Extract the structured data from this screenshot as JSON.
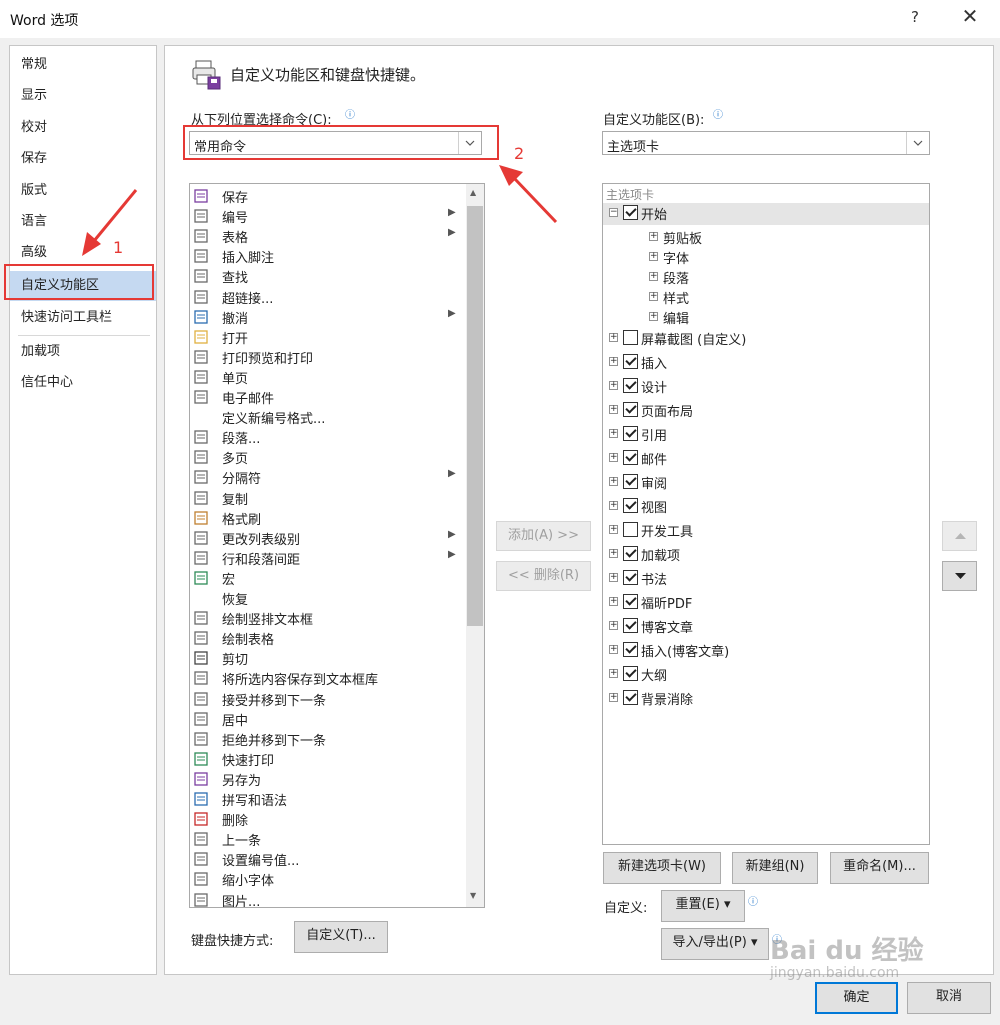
{
  "window": {
    "title": "Word 选项",
    "help": "?",
    "close": "✕"
  },
  "nav": {
    "items": [
      {
        "label": "常规"
      },
      {
        "label": "显示"
      },
      {
        "label": "校对"
      },
      {
        "label": "保存"
      },
      {
        "label": "版式"
      },
      {
        "label": "语言"
      },
      {
        "label": "高级"
      },
      {
        "label": "自定义功能区"
      },
      {
        "label": "快速访问工具栏"
      },
      {
        "label": "加载项"
      },
      {
        "label": "信任中心"
      }
    ],
    "selected": "自定义功能区"
  },
  "header": {
    "title": "自定义功能区和键盘快捷键。"
  },
  "left": {
    "choose_label": "从下列位置选择命令(C):",
    "choose_value": "常用命令",
    "commands": [
      {
        "label": "保存",
        "icon": "save-icon"
      },
      {
        "label": "编号",
        "icon": "numbering-icon",
        "submenu": true
      },
      {
        "label": "表格",
        "icon": "table-icon",
        "submenu": true
      },
      {
        "label": "插入脚注",
        "icon": "footnote-icon"
      },
      {
        "label": "查找",
        "icon": "find-icon"
      },
      {
        "label": "超链接...",
        "icon": "hyperlink-icon"
      },
      {
        "label": "撤消",
        "icon": "undo-icon",
        "submenu": true
      },
      {
        "label": "打开",
        "icon": "open-folder-icon"
      },
      {
        "label": "打印预览和打印",
        "icon": "print-preview-icon"
      },
      {
        "label": "单页",
        "icon": "single-page-icon"
      },
      {
        "label": "电子邮件",
        "icon": "email-icon"
      },
      {
        "label": "定义新编号格式...",
        "icon": ""
      },
      {
        "label": "段落...",
        "icon": "paragraph-icon"
      },
      {
        "label": "多页",
        "icon": "multi-page-icon"
      },
      {
        "label": "分隔符",
        "icon": "break-icon",
        "submenu": true
      },
      {
        "label": "复制",
        "icon": "copy-icon"
      },
      {
        "label": "格式刷",
        "icon": "format-painter-icon"
      },
      {
        "label": "更改列表级别",
        "icon": "list-level-icon",
        "submenu": true
      },
      {
        "label": "行和段落间距",
        "icon": "line-spacing-icon",
        "submenu": true
      },
      {
        "label": "宏",
        "icon": "macro-icon"
      },
      {
        "label": "恢复",
        "icon": ""
      },
      {
        "label": "绘制竖排文本框",
        "icon": "vertical-textbox-icon"
      },
      {
        "label": "绘制表格",
        "icon": "draw-table-icon"
      },
      {
        "label": "剪切",
        "icon": "cut-icon"
      },
      {
        "label": "将所选内容保存到文本框库",
        "icon": "save-to-gallery-icon"
      },
      {
        "label": "接受并移到下一条",
        "icon": "accept-next-icon"
      },
      {
        "label": "居中",
        "icon": "center-icon"
      },
      {
        "label": "拒绝并移到下一条",
        "icon": "reject-next-icon"
      },
      {
        "label": "快速打印",
        "icon": "quick-print-icon"
      },
      {
        "label": "另存为",
        "icon": "save-as-icon"
      },
      {
        "label": "拼写和语法",
        "icon": "spelling-icon"
      },
      {
        "label": "删除",
        "icon": "delete-icon"
      },
      {
        "label": "上一条",
        "icon": "previous-icon"
      },
      {
        "label": "设置编号值...",
        "icon": "numbering-value-icon"
      },
      {
        "label": "缩小字体",
        "icon": "shrink-font-icon"
      },
      {
        "label": "图片...",
        "icon": "picture-icon"
      }
    ],
    "shortcut_label": "键盘快捷方式:",
    "shortcut_button": "自定义(T)..."
  },
  "middle": {
    "add": "添加(A) >>",
    "remove": "<< 删除(R)"
  },
  "right": {
    "customize_label": "自定义功能区(B):",
    "customize_value": "主选项卡",
    "tree_header": "主选项卡",
    "tree": [
      {
        "label": "开始",
        "checked": true,
        "expanded": true,
        "children": [
          "剪贴板",
          "字体",
          "段落",
          "样式",
          "编辑"
        ]
      },
      {
        "label": "屏幕截图 (自定义)",
        "checked": false
      },
      {
        "label": "插入",
        "checked": true
      },
      {
        "label": "设计",
        "checked": true
      },
      {
        "label": "页面布局",
        "checked": true
      },
      {
        "label": "引用",
        "checked": true
      },
      {
        "label": "邮件",
        "checked": true
      },
      {
        "label": "审阅",
        "checked": true
      },
      {
        "label": "视图",
        "checked": true
      },
      {
        "label": "开发工具",
        "checked": false
      },
      {
        "label": "加载项",
        "checked": true
      },
      {
        "label": "书法",
        "checked": true
      },
      {
        "label": "福昕PDF",
        "checked": true
      },
      {
        "label": "博客文章",
        "checked": true
      },
      {
        "label": "插入(博客文章)",
        "checked": true
      },
      {
        "label": "大纲",
        "checked": true
      },
      {
        "label": "背景消除",
        "checked": true
      }
    ],
    "new_tab": "新建选项卡(W)",
    "new_group": "新建组(N)",
    "rename": "重命名(M)...",
    "customize2_label": "自定义:",
    "reset": "重置(E) ▾",
    "import_export": "导入/导出(P) ▾"
  },
  "footer": {
    "ok": "确定",
    "cancel": "取消"
  },
  "annotations": {
    "one": "1",
    "two": "2",
    "watermark": "Bai du 经验",
    "watermark_url": "jingyan.baidu.com"
  },
  "colors": {
    "highlight_red": "#e53935",
    "nav_selected": "#c5d9f1"
  }
}
